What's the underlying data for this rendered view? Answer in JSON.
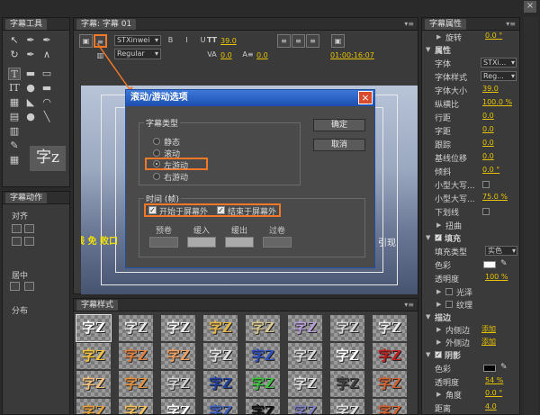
{
  "tools_panel": {
    "title": "字幕工具",
    "sample": "字z"
  },
  "actions_panel": {
    "title": "字幕动作",
    "align": "对齐",
    "center": "居中",
    "distribute": "分布"
  },
  "editor_panel": {
    "tab": "字幕: 字幕 01",
    "font_family": "STXinwei",
    "font_style": "Regular",
    "font_size": "39.0",
    "kerning": "0.0",
    "leading": "0.0",
    "timecode": "01:00:16:07",
    "canvas_overlay_left": "线 免 败口",
    "canvas_overlay_right": "引现"
  },
  "dialog": {
    "title": "滚动/游动选项",
    "type_group": "字幕类型",
    "types": [
      "静态",
      "滚动",
      "左游动",
      "右游动"
    ],
    "selected_type": "左游动",
    "ok": "确定",
    "cancel": "取消",
    "timing_group": "时间 (帧)",
    "start_offscreen": "开始于屏幕外",
    "end_offscreen": "结束于屏幕外",
    "fields": [
      "预卷",
      "缓入",
      "缓出",
      "过卷"
    ]
  },
  "styles_panel": {
    "title": "字幕样式",
    "sample": "字Z"
  },
  "properties_panel": {
    "title": "字幕属性",
    "rotation_label": "旋转",
    "rotation_value": "0.0 °",
    "section_properties": "属性",
    "font": "字体",
    "font_value": "STXi...",
    "font_style": "字体样式",
    "font_style_value": "Reg...",
    "font_size": "字体大小",
    "font_size_value": "39.0",
    "aspect": "纵横比",
    "aspect_value": "100.0 %",
    "leading": "行距",
    "leading_value": "0.0",
    "kerning": "字距",
    "kerning_value": "0.0",
    "tracking": "跟踪",
    "tracking_value": "0.0",
    "baseline": "基线位移",
    "baseline_value": "0.0",
    "slant": "倾斜",
    "slant_value": "0.0 °",
    "small_caps": "小型大写...",
    "small_caps_size": "小型大写...",
    "small_caps_size_value": "75.0 %",
    "underline": "下划线",
    "distort": "扭曲",
    "section_fill": "填充",
    "fill_type": "填充类型",
    "fill_type_value": "实色",
    "color": "色彩",
    "opacity": "透明度",
    "opacity_value": "100 %",
    "sheen": "光泽",
    "texture": "纹理",
    "section_stroke": "描边",
    "inner_stroke": "内侧边",
    "add_inner": "添加",
    "outer_stroke": "外侧边",
    "add_outer": "添加",
    "section_shadow": "阴影",
    "shadow_color": "色彩",
    "shadow_opacity": "透明度",
    "shadow_opacity_value": "54 %",
    "angle": "角度",
    "angle_value": "0.0 °",
    "distance": "距离",
    "distance_value": "4.0"
  },
  "colors": {
    "accent": "#f07828",
    "value": "#e6c300",
    "dialog_title": "#2a5fc8"
  }
}
